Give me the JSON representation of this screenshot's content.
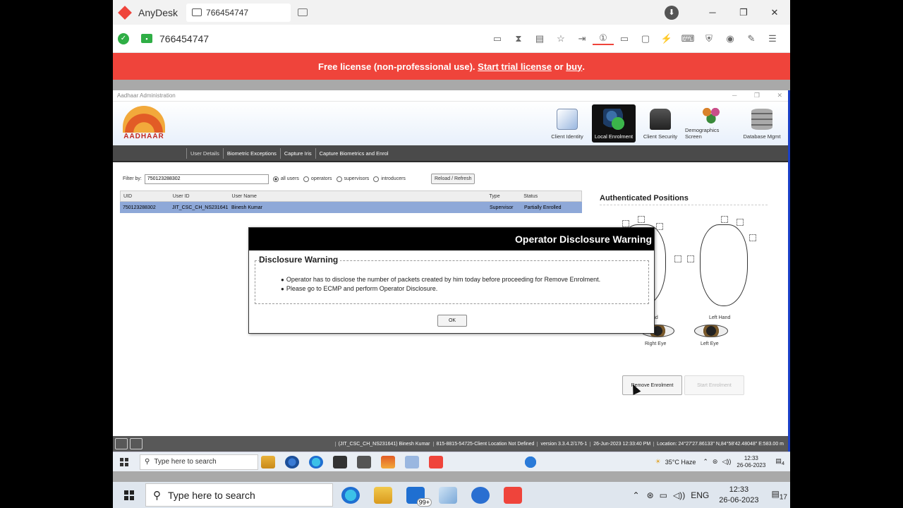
{
  "anydesk": {
    "app_name": "AnyDesk",
    "tab_label": "766454747",
    "address": "766454747",
    "license_text": "Free license (non-professional use).",
    "license_link1": "Start trial license",
    "license_or": "or",
    "license_link2": "buy",
    "license_end": ".",
    "accent": "#ef443b"
  },
  "app": {
    "window_title": "Aadhaar Administration",
    "logo_text": "AADHAAR",
    "nav": [
      {
        "label": "Client Identity",
        "icon": "clipboard-icon"
      },
      {
        "label": "Local Enrolment",
        "icon": "user-add-icon",
        "active": true
      },
      {
        "label": "Client Security",
        "icon": "lock-icon"
      },
      {
        "label": "Demographics Screen",
        "icon": "people-icon"
      },
      {
        "label": "Database Mgmt",
        "icon": "database-icon"
      }
    ],
    "menu": [
      "User Details",
      "Biometric Exceptions",
      "Capture Iris",
      "Capture Biometrics and Enrol"
    ],
    "filter": {
      "label": "Filter by:",
      "value": "750123288302",
      "options": [
        "all users",
        "operators",
        "supervisors",
        "introducers"
      ],
      "reload": "Reload / Refresh"
    },
    "table": {
      "headers": [
        "UID",
        "User ID",
        "User Name",
        "Type",
        "Status"
      ],
      "rows": [
        [
          "750123288302",
          "JIT_CSC_CH_NS231641",
          "Binesh Kumar",
          "Supervisor",
          "Partially Enrolled"
        ]
      ]
    },
    "auth_title": "Authenticated Positions",
    "labels": {
      "left_hand": "Left Hand",
      "right_hand_fragment": "nd",
      "right_eye": "Right Eye",
      "left_eye": "Left Eye"
    },
    "buttons": {
      "remove": "Remove Enrolment",
      "start": "Start Enrolment"
    },
    "status": {
      "user": "(JIT_CSC_CH_NS231641) Binesh Kumar",
      "location": "815-8815-54725-Client Location Not Defined",
      "version": "version 3.3.4.2/176-1",
      "datetime": "26-Jun-2023 12:33:40 PM",
      "coords": "Location: 24°27'27.86133\" N,84°58'42.48048\" E:583.00 m"
    }
  },
  "dialog": {
    "title": "Operator Disclosure Warning",
    "legend": "Disclosure Warning",
    "lines": [
      "Operator has to disclose the number of packets created by him today before proceeding for Remove Enrolment.",
      "Please go to ECMP and perform Operator Disclosure."
    ],
    "ok": "OK"
  },
  "remote_taskbar": {
    "search": "Type here to search",
    "weather": "35°C",
    "weather_desc": "Haze",
    "time": "12:33",
    "date": "26-06-2023",
    "notif": "4"
  },
  "local_taskbar": {
    "search": "Type here to search",
    "badge": "99+",
    "lang": "ENG",
    "time": "12:33",
    "date": "26-06-2023",
    "notif": "17"
  }
}
